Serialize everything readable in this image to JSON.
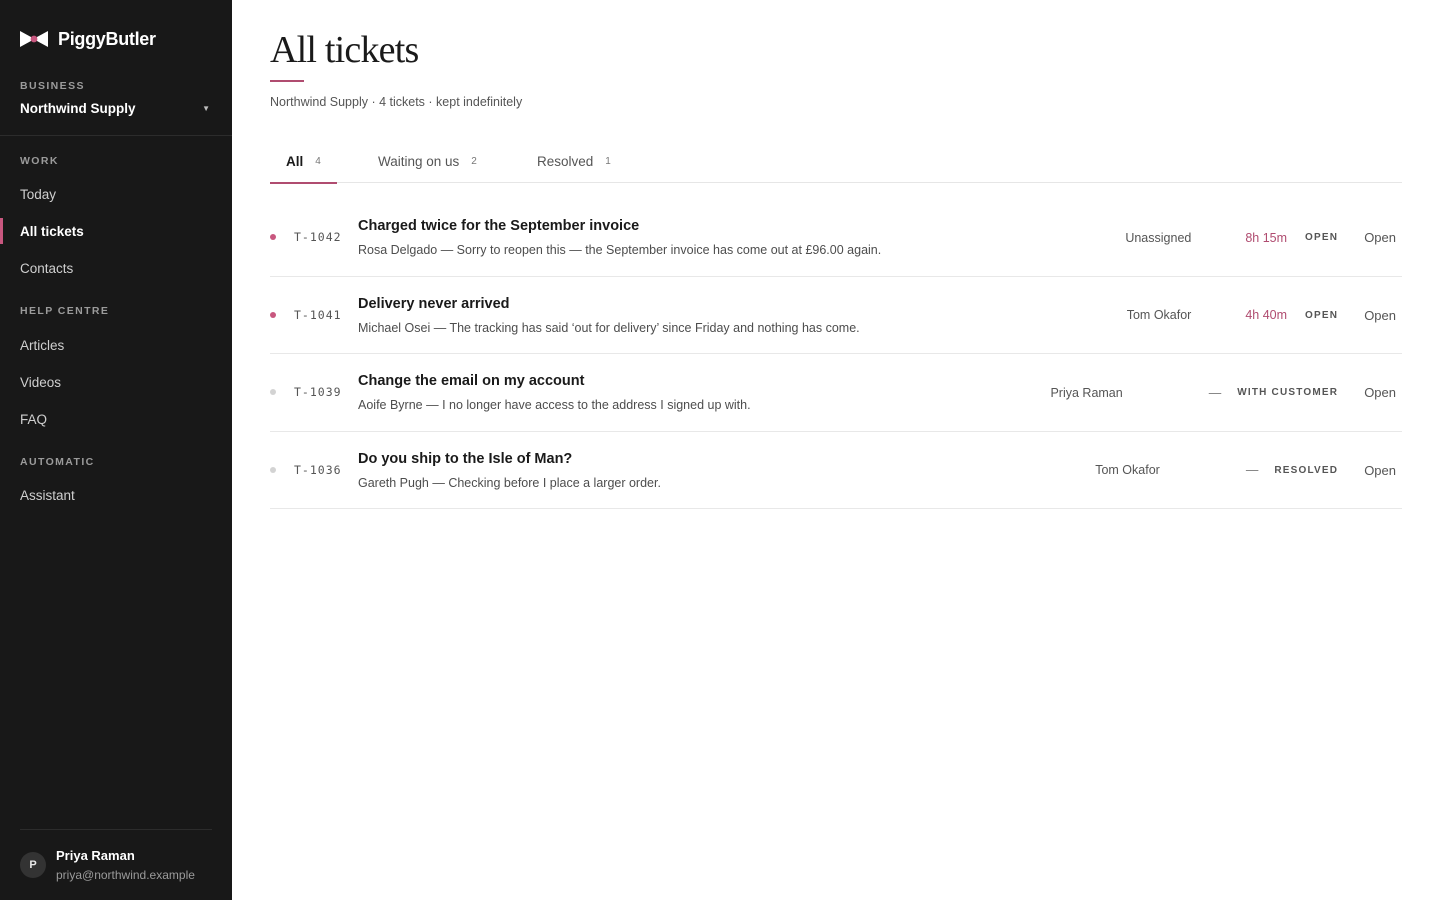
{
  "brand": {
    "name": "PiggyButler",
    "accent": "#c8577f"
  },
  "sidebar": {
    "business_label": "BUSINESS",
    "business_name": "Northwind Supply",
    "sections": [
      {
        "label": "WORK",
        "items": [
          {
            "label": "Today",
            "active": false
          },
          {
            "label": "All tickets",
            "active": true
          },
          {
            "label": "Contacts",
            "active": false
          }
        ]
      },
      {
        "label": "HELP CENTRE",
        "items": [
          {
            "label": "Articles",
            "active": false
          },
          {
            "label": "Videos",
            "active": false
          },
          {
            "label": "FAQ",
            "active": false
          }
        ]
      },
      {
        "label": "AUTOMATIC",
        "items": [
          {
            "label": "Assistant",
            "active": false
          }
        ]
      }
    ],
    "user": {
      "initial": "P",
      "name": "Priya Raman",
      "email": "priya@northwind.example"
    }
  },
  "page": {
    "title": "All tickets",
    "subtitle": "Northwind Supply · 4 tickets · kept indefinitely"
  },
  "tabs": [
    {
      "label": "All",
      "count": "4",
      "active": true
    },
    {
      "label": "Waiting on us",
      "count": "2",
      "active": false
    },
    {
      "label": "Resolved",
      "count": "1",
      "active": false
    }
  ],
  "tickets": [
    {
      "id": "T-1042",
      "unread": true,
      "subject": "Charged twice for the September invoice",
      "snippet": "Rosa Delgado — Sorry to reopen this — the September invoice has come out at £96.00 again.",
      "assignee": "Unassigned",
      "sla": "8h 15m",
      "status": "OPEN",
      "action": "Open"
    },
    {
      "id": "T-1041",
      "unread": true,
      "subject": "Delivery never arrived",
      "snippet": "Michael Osei — The tracking has said ‘out for delivery’ since Friday and nothing has come.",
      "assignee": "Tom Okafor",
      "sla": "4h 40m",
      "status": "OPEN",
      "action": "Open"
    },
    {
      "id": "T-1039",
      "unread": false,
      "subject": "Change the email on my account",
      "snippet": "Aoife Byrne — I no longer have access to the address I signed up with.",
      "assignee": "Priya Raman",
      "sla": "—",
      "status": "WITH CUSTOMER",
      "action": "Open"
    },
    {
      "id": "T-1036",
      "unread": false,
      "subject": "Do you ship to the Isle of Man?",
      "snippet": "Gareth Pugh — Checking before I place a larger order.",
      "assignee": "Tom Okafor",
      "sla": "—",
      "status": "RESOLVED",
      "action": "Open"
    }
  ]
}
